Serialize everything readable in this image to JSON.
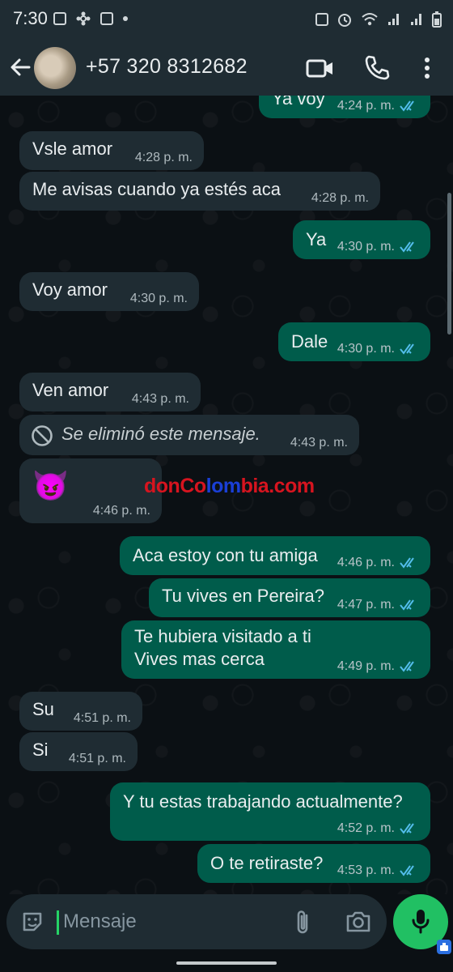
{
  "status_bar": {
    "time": "7:30"
  },
  "header": {
    "contact": "+57 320 8312682"
  },
  "messages": [
    {
      "text": "Ya voy",
      "time": "4:24 p. m."
    },
    {
      "text": "Vsle amor",
      "time": "4:28 p. m."
    },
    {
      "text": "Me avisas cuando ya estés aca",
      "time": "4:28 p. m."
    },
    {
      "text": "Ya",
      "time": "4:30 p. m."
    },
    {
      "text": "Voy amor",
      "time": "4:30 p. m."
    },
    {
      "text": "Dale",
      "time": "4:30 p. m."
    },
    {
      "text": "Ven amor",
      "time": "4:43 p. m."
    },
    {
      "text": "Se eliminó este mensaje.",
      "time": "4:43 p. m."
    },
    {
      "text": "😈",
      "time": "4:46 p. m."
    },
    {
      "text": "Aca estoy con tu amiga",
      "time": "4:46 p. m."
    },
    {
      "text": "Tu vives en Pereira?",
      "time": "4:47 p. m."
    },
    {
      "text": "Te hubiera visitado a ti\nVives mas cerca",
      "time": "4:49 p. m."
    },
    {
      "text": "Su",
      "time": "4:51 p. m."
    },
    {
      "text": "Si",
      "time": "4:51 p. m."
    },
    {
      "text": "Y tu estas trabajando actualmente?",
      "time": "4:52 p. m."
    },
    {
      "text": "O te retiraste?",
      "time": "4:53 p. m."
    }
  ],
  "watermark": {
    "part1": "donCo",
    "part2": "lom",
    "part3": "bia.com"
  },
  "composer": {
    "placeholder": "Mensaje"
  },
  "colors": {
    "incoming": "#1f2c33",
    "outgoing": "#005c4b",
    "accent": "#21c063",
    "read_ticks": "#53bdeb"
  }
}
